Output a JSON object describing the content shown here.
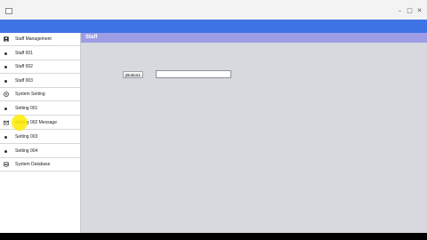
{
  "window": {
    "controls": {
      "minimize": "–",
      "maximize": "□",
      "close": "✕"
    }
  },
  "sidebar": {
    "items": [
      {
        "label": "Staff Management",
        "icon": "person-icon"
      },
      {
        "label": "Staff 001",
        "icon": "bullet-icon"
      },
      {
        "label": "Staff 002",
        "icon": "bullet-icon"
      },
      {
        "label": "Staff 003",
        "icon": "bullet-icon"
      },
      {
        "label": "System Setting",
        "icon": "settings-icon"
      },
      {
        "label": "Setting 001",
        "icon": "bullet-icon"
      },
      {
        "label": "Setting 002 Message",
        "icon": "envelope-icon"
      },
      {
        "label": "Setting 003",
        "icon": "bullet-icon"
      },
      {
        "label": "Setting 004",
        "icon": "bullet-icon"
      },
      {
        "label": "System Database",
        "icon": "database-icon"
      }
    ]
  },
  "main": {
    "title": "Staff",
    "button_label": "jButton1",
    "text_field_value": ""
  },
  "colors": {
    "accent_band": "#3e73e6",
    "panel_header": "#9d9de6",
    "content_bg": "#d8d9de"
  }
}
